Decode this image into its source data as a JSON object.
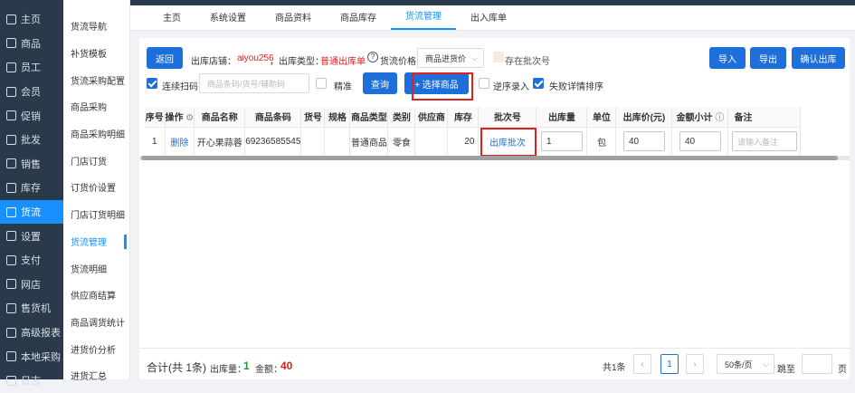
{
  "sidebar": {
    "items": [
      {
        "label": "主页",
        "icon": "home-icon"
      },
      {
        "label": "商品",
        "icon": "goods-icon"
      },
      {
        "label": "员工",
        "icon": "staff-icon"
      },
      {
        "label": "会员",
        "icon": "member-icon"
      },
      {
        "label": "促销",
        "icon": "promo-icon"
      },
      {
        "label": "批发",
        "icon": "wholesale-icon"
      },
      {
        "label": "销售",
        "icon": "sales-icon"
      },
      {
        "label": "库存",
        "icon": "stock-icon"
      },
      {
        "label": "货流",
        "icon": "flow-icon"
      },
      {
        "label": "设置",
        "icon": "settings-icon"
      },
      {
        "label": "支付",
        "icon": "pay-icon"
      },
      {
        "label": "网店",
        "icon": "shop-icon"
      },
      {
        "label": "售货机",
        "icon": "vending-icon"
      },
      {
        "label": "高级报表",
        "icon": "report-icon"
      },
      {
        "label": "本地采购",
        "icon": "purchase-icon"
      },
      {
        "label": "日志",
        "icon": "log-icon"
      }
    ],
    "active": "货流"
  },
  "subnav": {
    "items": [
      "货流导航",
      "补货模板",
      "货流采购配置",
      "商品采购",
      "商品采购明细",
      "门店订货",
      "订货价设置",
      "门店订货明细",
      "货流管理",
      "货流明细",
      "供应商结算",
      "商品调货统计",
      "进货价分析",
      "进货汇总"
    ],
    "active": "货流管理"
  },
  "tabs": [
    "主页",
    "系统设置",
    "商品资料",
    "商品库存",
    "货流管理",
    "出入库单"
  ],
  "toolbar": {
    "back": "返回",
    "store_label": "出库店铺：",
    "store_value": "aiyou256",
    "type_label": "，出库类型：",
    "type_value": "普通出库单",
    "price_label": "货流价格：",
    "price_select": "商品进货价",
    "batch_label": "存在批次号",
    "import": "导入",
    "export": "导出",
    "confirm": "确认出库",
    "scan_label": "连续扫码",
    "search_placeholder": "商品条码/货号/辅助码",
    "exact_label": "精准",
    "query": "查询",
    "select_goods": "+ 选择商品",
    "reverse_label": "逆序录入",
    "fail_sort_label": "失败详情排序"
  },
  "table": {
    "headers": [
      "序号",
      "操作",
      "商品名称",
      "商品条码",
      "货号",
      "规格",
      "商品类型",
      "类别",
      "供应商",
      "库存",
      "批次号",
      "出库量",
      "单位",
      "出库价(元)",
      "金额小计",
      "备注"
    ],
    "rows": [
      {
        "index": "1",
        "action": "删除",
        "name": "开心果蒜蓉",
        "barcode": "69236585545",
        "sku": "",
        "spec": "",
        "type": "普通商品",
        "category": "零食",
        "supplier": "",
        "stock": "20",
        "batch": "出库批次",
        "qty": "1",
        "unit": "包",
        "price": "40",
        "subtotal": "40",
        "remark_placeholder": "请输入备注"
      }
    ]
  },
  "footer": {
    "total_label": "合计(共 1条)",
    "qty_label": "出库量：",
    "qty_value": "1",
    "amount_label": "金额：",
    "amount_value": "40",
    "records": "共1条",
    "page": "1",
    "page_size": "50条/页",
    "jump_label": "跳至",
    "page_unit": "页"
  },
  "colors": {
    "accent": "#1e6fd9",
    "sidebar": "#2b3a4a",
    "highlight": "#e02020"
  }
}
